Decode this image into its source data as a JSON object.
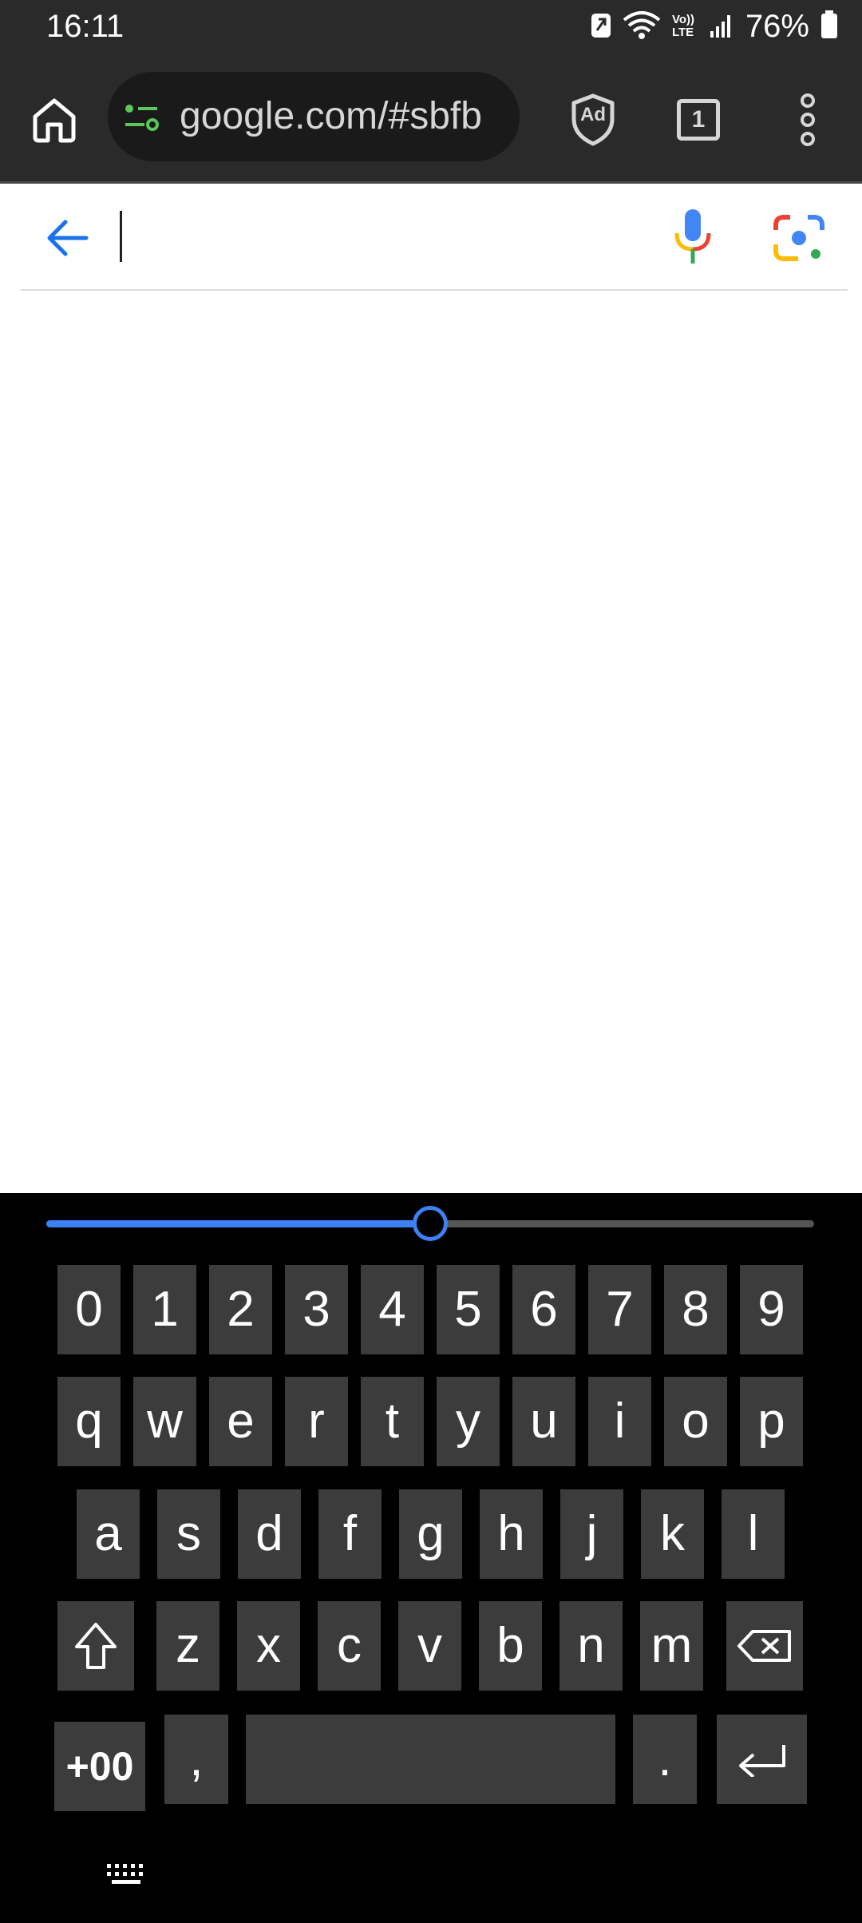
{
  "status_bar": {
    "time": "16:11",
    "volte_label": "Vo)) LTE",
    "battery_percent": "76%",
    "icons": [
      "data-saver-icon",
      "wifi-icon",
      "volte-icon",
      "signal-icon",
      "battery-icon"
    ]
  },
  "toolbar": {
    "url": "google.com/#sbfb",
    "ad_block_label": "Ad",
    "tab_count": "1",
    "icons": [
      "home-icon",
      "site-settings-icon",
      "ad-block-icon",
      "tabs-icon",
      "more-vert-icon"
    ]
  },
  "search": {
    "value": "",
    "placeholder": "",
    "icons": [
      "back-arrow-icon",
      "mic-icon",
      "google-lens-icon"
    ]
  },
  "keyboard": {
    "size_slider_level": 0.5,
    "row_numbers": [
      "0",
      "1",
      "2",
      "3",
      "4",
      "5",
      "6",
      "7",
      "8",
      "9"
    ],
    "row_top": [
      "q",
      "w",
      "e",
      "r",
      "t",
      "y",
      "u",
      "i",
      "o",
      "p"
    ],
    "row_home": [
      "a",
      "s",
      "d",
      "f",
      "g",
      "h",
      "j",
      "k",
      "l"
    ],
    "row_bottom": [
      "z",
      "x",
      "c",
      "v",
      "b",
      "n",
      "m"
    ],
    "special_label": "+00",
    "comma": ",",
    "period": ".",
    "icons": [
      "shift-icon",
      "backspace-icon",
      "enter-icon",
      "keyboard-switch-icon"
    ]
  },
  "colors": {
    "accent_blue": "#3b82f6",
    "toolbar_bg": "#2a2a2a",
    "key_bg": "#3c3c3c",
    "google_blue": "#4285f4",
    "google_red": "#ea4335",
    "google_yellow": "#fbbc04",
    "google_green": "#34a853"
  }
}
